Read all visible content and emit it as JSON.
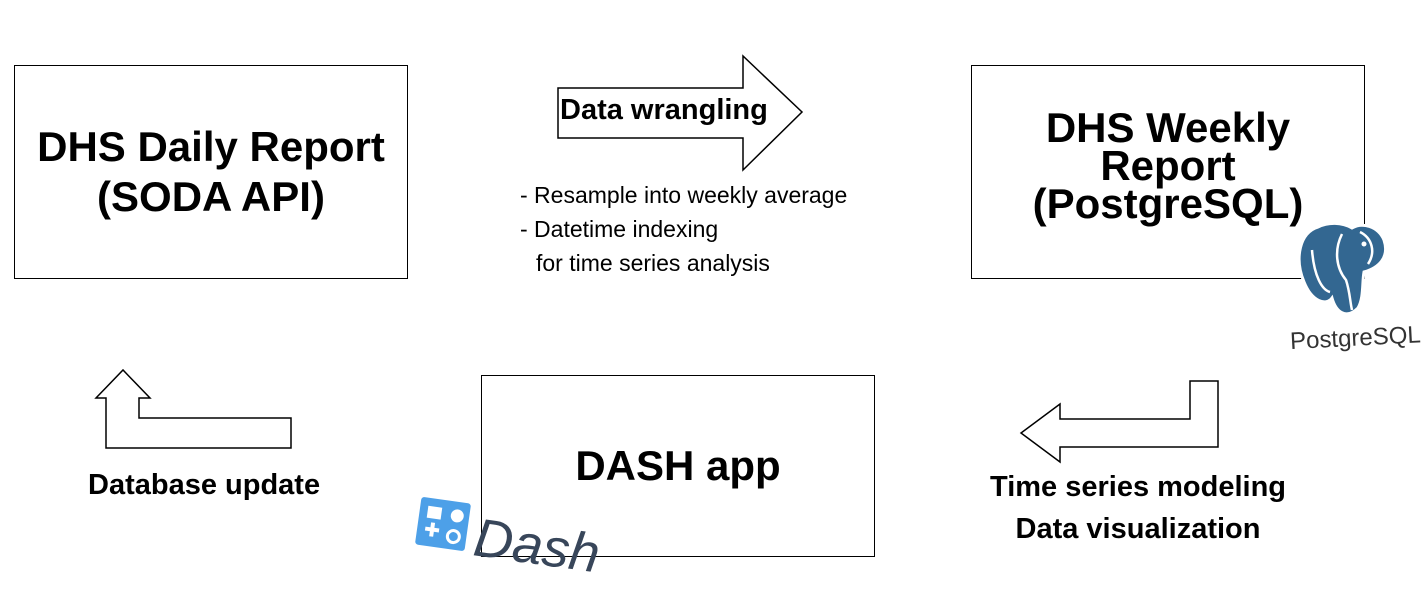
{
  "boxes": {
    "daily": {
      "line1": "DHS Daily Report",
      "line2": "(SODA API)"
    },
    "weekly": {
      "line1": "DHS Weekly",
      "line2": "Report",
      "line3": "(PostgreSQL)"
    },
    "dash": {
      "line1": "DASH app"
    }
  },
  "arrows": {
    "wrangling": {
      "label": "Data wrangling",
      "notes": [
        "- Resample into weekly average",
        "- Datetime indexing",
        "for time series analysis"
      ]
    },
    "modeling": {
      "line1": "Time series modeling",
      "line2": "Data visualization"
    },
    "update": {
      "label": "Database update"
    }
  },
  "logos": {
    "postgresql": {
      "icon": "postgresql-elephant-icon",
      "text": "PostgreSQL",
      "color": "#336791"
    },
    "dash": {
      "icon": "dash-logo-icon",
      "text": "Dash",
      "color": "#4DA0E8",
      "text_color": "#38465A"
    }
  }
}
